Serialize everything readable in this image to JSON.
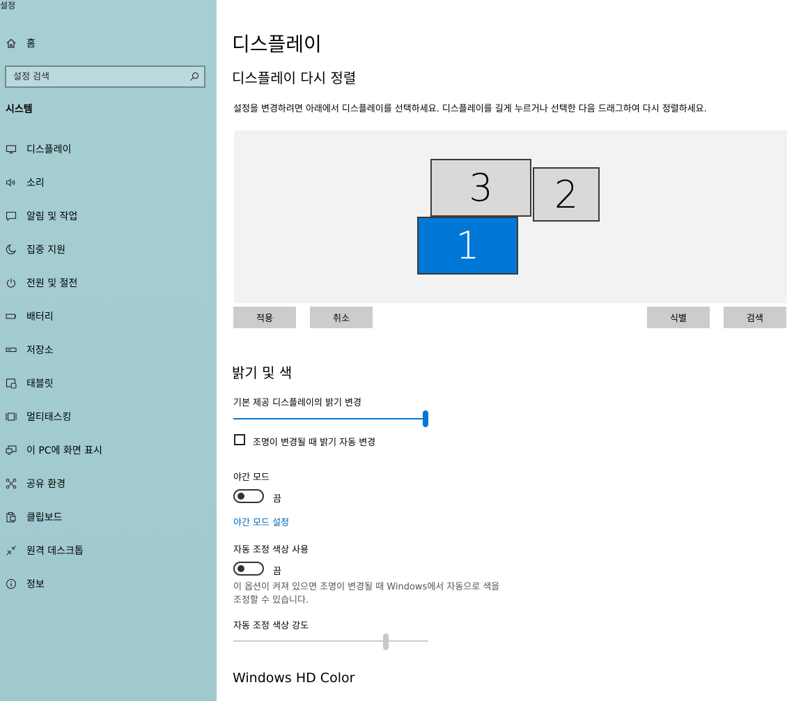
{
  "app_title": "설정",
  "sidebar": {
    "home_label": "홈",
    "search_placeholder": "설정 검색",
    "section_title": "시스템",
    "items": [
      {
        "label": "디스플레이",
        "icon": "monitor-icon"
      },
      {
        "label": "소리",
        "icon": "speaker-icon"
      },
      {
        "label": "알림 및 작업",
        "icon": "notification-icon"
      },
      {
        "label": "집중 지원",
        "icon": "moon-icon"
      },
      {
        "label": "전원 및 절전",
        "icon": "power-icon"
      },
      {
        "label": "배터리",
        "icon": "battery-icon"
      },
      {
        "label": "저장소",
        "icon": "storage-icon"
      },
      {
        "label": "태블릿",
        "icon": "tablet-icon"
      },
      {
        "label": "멀티태스킹",
        "icon": "multitasking-icon"
      },
      {
        "label": "이 PC에 화면 표시",
        "icon": "project-icon"
      },
      {
        "label": "공유 환경",
        "icon": "share-icon"
      },
      {
        "label": "클립보드",
        "icon": "clipboard-icon"
      },
      {
        "label": "원격 데스크톱",
        "icon": "remote-desktop-icon"
      },
      {
        "label": "정보",
        "icon": "info-icon"
      }
    ]
  },
  "main": {
    "title": "디스플레이",
    "rearrange_heading": "디스플레이 다시 정렬",
    "rearrange_desc": "설정을 변경하려면 아래에서 디스플레이를 선택하세요. 디스플레이를 길게 누르거나 선택한 다음 드래그하여 다시 정렬하세요.",
    "monitors": [
      {
        "number": "3",
        "selected": false
      },
      {
        "number": "2",
        "selected": false
      },
      {
        "number": "1",
        "selected": true
      }
    ],
    "buttons": {
      "apply": "적용",
      "cancel": "취소",
      "identify": "식별",
      "detect": "검색"
    },
    "brightness": {
      "heading": "밝기 및 색",
      "slider_label": "기본 제공 디스플레이의 밝기 변경",
      "value_percent": 100,
      "auto_checkbox_label": "조명이 변경될 때 밝기 자동 변경",
      "auto_checked": false
    },
    "night_light": {
      "label": "야간 모드",
      "state": "끔",
      "settings_link": "야간 모드 설정"
    },
    "adaptive_color": {
      "label": "자동 조정 색상 사용",
      "state": "끔",
      "help_line1": "이 옵션이 켜져 있으면 조명이 변경될 때 Windows에서 자동으로 색을",
      "help_line2": "조정할 수 있습니다.",
      "strength_label": "자동 조정 색상 강도",
      "strength_percent": 78
    },
    "hd_color_heading": "Windows HD Color"
  },
  "colors": {
    "accent": "#0078d7",
    "link": "#0067b8",
    "sidebar_bg": "#a3ccd1"
  }
}
